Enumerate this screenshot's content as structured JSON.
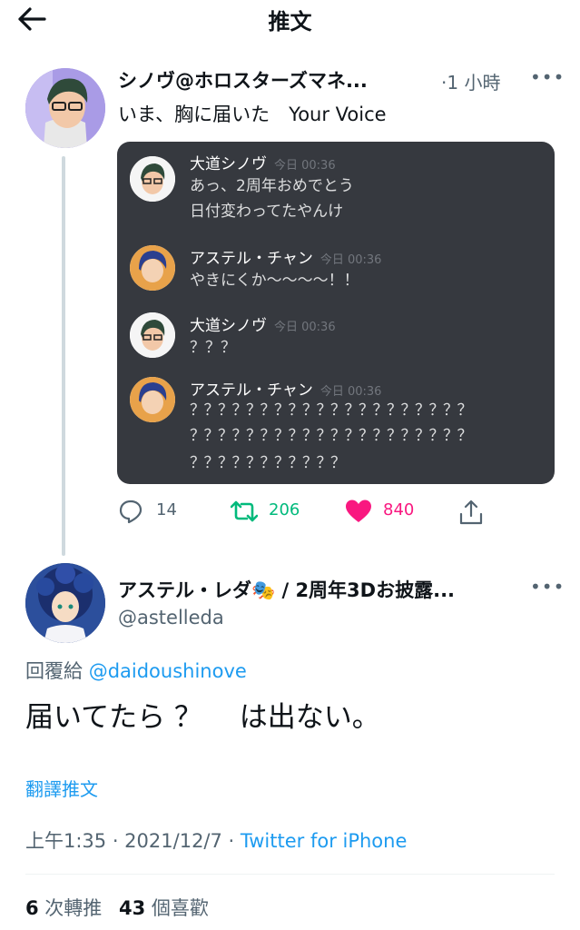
{
  "header": {
    "title": "推文"
  },
  "parent": {
    "name": "シノヴ@ホロスターズマネ...",
    "time": "·1 小時",
    "text": "いま、胸に届いた　Your Voice",
    "chat": [
      {
        "name": "大道シノヴ",
        "time": "今日 00:36",
        "lines": [
          "あっ、2周年おめでとう",
          "日付変わってたやんけ"
        ]
      },
      {
        "name": "アステル・チャン",
        "time": "今日 00:36",
        "lines": [
          "やきにくか〜〜〜〜！！"
        ]
      },
      {
        "name": "大道シノヴ",
        "time": "今日 00:36",
        "lines": [
          "？？？"
        ]
      },
      {
        "name": "アステル・チャン",
        "time": "今日 00:36",
        "lines": [
          "？？？？？？？？？？？？？？？？？？？？",
          "？？？？？？？？？？？？？？？？？？？？",
          "？？？？？？？？？？？"
        ]
      }
    ],
    "actions": {
      "replies": "14",
      "retweets": "206",
      "likes": "840"
    }
  },
  "reply": {
    "name": "アステル・レダ🎭 / 2周年3Dお披露...",
    "handle": "@astelleda",
    "reply_prefix": "回覆給 ",
    "reply_mention": "@daidoushinove",
    "text": "届いてたら ？　 は出ない。",
    "translate": "翻譯推文",
    "timestamp": "上午1:35 · 2021/12/7 · ",
    "source": "Twitter for iPhone",
    "retweet_count": "6",
    "retweet_label": " 次轉推",
    "like_count": "43",
    "like_label": " 個喜歡"
  },
  "colors": {
    "accent": "#1d9bf0",
    "retweet": "#00ba7c",
    "like": "#f91880",
    "media_bg": "#36393f"
  }
}
